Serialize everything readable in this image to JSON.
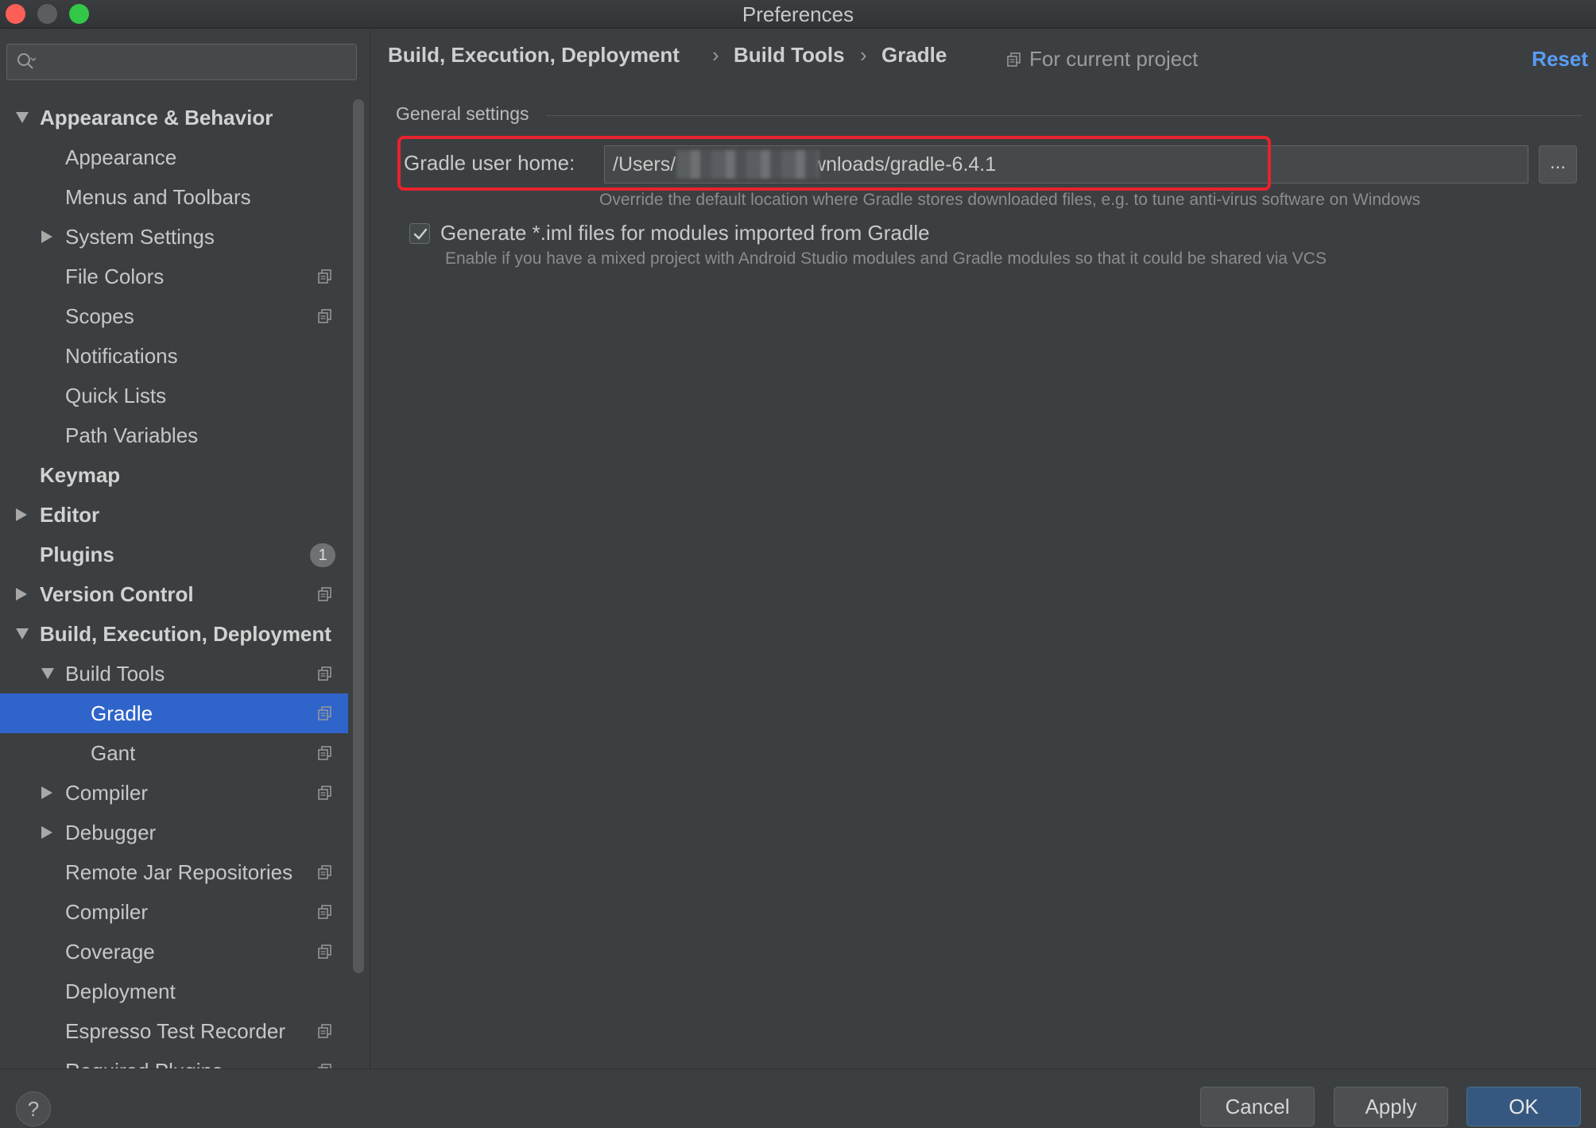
{
  "window": {
    "title": "Preferences"
  },
  "search": {
    "placeholder": "",
    "value": ""
  },
  "sidebar": {
    "items": [
      {
        "label": "Appearance & Behavior",
        "level": 0,
        "bold": true,
        "expander": "expanded",
        "project_icon": false
      },
      {
        "label": "Appearance",
        "level": 1,
        "bold": false,
        "expander": "none",
        "project_icon": false
      },
      {
        "label": "Menus and Toolbars",
        "level": 1,
        "bold": false,
        "expander": "none",
        "project_icon": false
      },
      {
        "label": "System Settings",
        "level": 1,
        "bold": false,
        "expander": "collapsed",
        "project_icon": false
      },
      {
        "label": "File Colors",
        "level": 1,
        "bold": false,
        "expander": "none",
        "project_icon": true
      },
      {
        "label": "Scopes",
        "level": 1,
        "bold": false,
        "expander": "none",
        "project_icon": true
      },
      {
        "label": "Notifications",
        "level": 1,
        "bold": false,
        "expander": "none",
        "project_icon": false
      },
      {
        "label": "Quick Lists",
        "level": 1,
        "bold": false,
        "expander": "none",
        "project_icon": false
      },
      {
        "label": "Path Variables",
        "level": 1,
        "bold": false,
        "expander": "none",
        "project_icon": false
      },
      {
        "label": "Keymap",
        "level": 0,
        "bold": true,
        "expander": "none",
        "project_icon": false
      },
      {
        "label": "Editor",
        "level": 0,
        "bold": true,
        "expander": "collapsed",
        "project_icon": false
      },
      {
        "label": "Plugins",
        "level": 0,
        "bold": true,
        "expander": "none",
        "project_icon": false,
        "badge": "1"
      },
      {
        "label": "Version Control",
        "level": 0,
        "bold": true,
        "expander": "collapsed",
        "project_icon": true
      },
      {
        "label": "Build, Execution, Deployment",
        "level": 0,
        "bold": true,
        "expander": "expanded",
        "project_icon": false
      },
      {
        "label": "Build Tools",
        "level": 1,
        "bold": false,
        "expander": "expanded",
        "project_icon": true
      },
      {
        "label": "Gradle",
        "level": 2,
        "bold": false,
        "expander": "none",
        "project_icon": true,
        "selected": true
      },
      {
        "label": "Gant",
        "level": 2,
        "bold": false,
        "expander": "none",
        "project_icon": true
      },
      {
        "label": "Compiler",
        "level": 1,
        "bold": false,
        "expander": "collapsed",
        "project_icon": true
      },
      {
        "label": "Debugger",
        "level": 1,
        "bold": false,
        "expander": "collapsed",
        "project_icon": false
      },
      {
        "label": "Remote Jar Repositories",
        "level": 1,
        "bold": false,
        "expander": "none",
        "project_icon": true
      },
      {
        "label": "Compiler",
        "level": 1,
        "bold": false,
        "expander": "none",
        "project_icon": true
      },
      {
        "label": "Coverage",
        "level": 1,
        "bold": false,
        "expander": "none",
        "project_icon": true
      },
      {
        "label": "Deployment",
        "level": 1,
        "bold": false,
        "expander": "none",
        "project_icon": false
      },
      {
        "label": "Espresso Test Recorder",
        "level": 1,
        "bold": false,
        "expander": "none",
        "project_icon": true
      },
      {
        "label": "Required Plugins",
        "level": 1,
        "bold": false,
        "expander": "none",
        "project_icon": true
      }
    ]
  },
  "breadcrumb": {
    "items": [
      "Build, Execution, Deployment",
      "Build Tools",
      "Gradle"
    ],
    "separator": "›"
  },
  "scope_note": "For current project",
  "reset_label": "Reset",
  "general": {
    "section_title": "General settings",
    "gradle_home_label": "Gradle user home:",
    "gradle_home_value": "/Users/                    Downloads/gradle-6.4.1",
    "gradle_home_hint": "Override the default location where Gradle stores downloaded files, e.g. to tune anti-virus software on Windows",
    "browse_label": "...",
    "generate_iml_label": "Generate *.iml files for modules imported from Gradle",
    "generate_iml_checked": true,
    "generate_iml_hint": "Enable if you have a mixed project with Android Studio modules and Gradle modules so that it could be shared via VCS"
  },
  "footer": {
    "help_label": "?",
    "cancel_label": "Cancel",
    "apply_label": "Apply",
    "ok_label": "OK"
  },
  "colors": {
    "selection": "#2f65ca",
    "highlight_box": "#e8222e",
    "link": "#589df6"
  },
  "icons": {
    "search": "search-icon",
    "project_scope": "project-settings-icon",
    "checkbox_check": "check-icon"
  }
}
